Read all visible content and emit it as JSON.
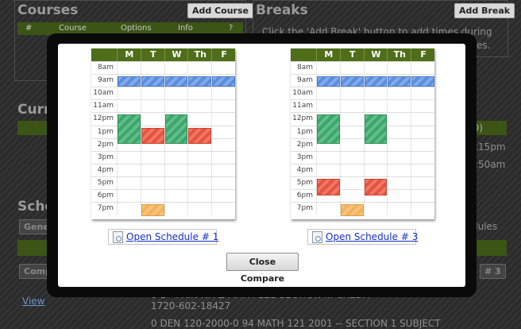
{
  "background": {
    "courses_title": "Courses",
    "add_course_label": "Add Course",
    "breaks_title": "Breaks",
    "add_break_label": "Add Break",
    "breaks_text_1": "Click the 'Add Break' button to add times during",
    "breaks_text_2": "es.",
    "table_headers": [
      "#",
      "Course",
      "Options",
      "Info",
      "?"
    ],
    "current_title": "Curr",
    "schedule_title": "Sche",
    "gen_label": "Gene",
    "compare_label": "Compa",
    "tag_3": "# 3",
    "view_link": "View",
    "time_1": ":15pm",
    "time_2": ":50am",
    "paren_d": "D)",
    "dules_text": "dules",
    "bottom_text_1": "0 1 - PRIN NH Z MATH 121 SECTION ... CREDIT",
    "bottom_text_2": "1720-602-18427",
    "bottom_text_3": "0 DEN 120-2000-0 94 MATH 121 2001 -- SECTION 1 SUBJECT"
  },
  "compare": {
    "days": [
      "M",
      "T",
      "W",
      "Th",
      "F"
    ],
    "times": [
      "8am",
      "9am",
      "10am",
      "11am",
      "12pm",
      "1pm",
      "2pm",
      "3pm",
      "4pm",
      "5pm",
      "6pm",
      "7pm"
    ],
    "schedules": [
      {
        "link_label": "Open Schedule # 1",
        "blocks": [
          {
            "day": 0,
            "start": 9.0,
            "end": 9.8,
            "color": "blue"
          },
          {
            "day": 1,
            "start": 9.0,
            "end": 9.8,
            "color": "blue"
          },
          {
            "day": 2,
            "start": 9.0,
            "end": 9.8,
            "color": "blue"
          },
          {
            "day": 3,
            "start": 9.0,
            "end": 9.8,
            "color": "blue"
          },
          {
            "day": 4,
            "start": 9.0,
            "end": 9.8,
            "color": "blue"
          },
          {
            "day": 0,
            "start": 12.0,
            "end": 14.3,
            "color": "green"
          },
          {
            "day": 2,
            "start": 12.0,
            "end": 14.3,
            "color": "green"
          },
          {
            "day": 1,
            "start": 13.0,
            "end": 14.3,
            "color": "red"
          },
          {
            "day": 3,
            "start": 13.0,
            "end": 14.3,
            "color": "red"
          },
          {
            "day": 1,
            "start": 19.0,
            "end": 19.9,
            "color": "orange"
          }
        ]
      },
      {
        "link_label": "Open Schedule # 3",
        "blocks": [
          {
            "day": 0,
            "start": 9.0,
            "end": 9.8,
            "color": "blue"
          },
          {
            "day": 1,
            "start": 9.0,
            "end": 9.8,
            "color": "blue"
          },
          {
            "day": 2,
            "start": 9.0,
            "end": 9.8,
            "color": "blue"
          },
          {
            "day": 3,
            "start": 9.0,
            "end": 9.8,
            "color": "blue"
          },
          {
            "day": 4,
            "start": 9.0,
            "end": 9.8,
            "color": "blue"
          },
          {
            "day": 0,
            "start": 12.0,
            "end": 14.3,
            "color": "green"
          },
          {
            "day": 2,
            "start": 12.0,
            "end": 14.3,
            "color": "green"
          },
          {
            "day": 0,
            "start": 17.0,
            "end": 18.3,
            "color": "red"
          },
          {
            "day": 2,
            "start": 17.0,
            "end": 18.3,
            "color": "red"
          },
          {
            "day": 1,
            "start": 19.0,
            "end": 19.9,
            "color": "orange"
          }
        ]
      }
    ],
    "close_label": "Close Compare"
  }
}
